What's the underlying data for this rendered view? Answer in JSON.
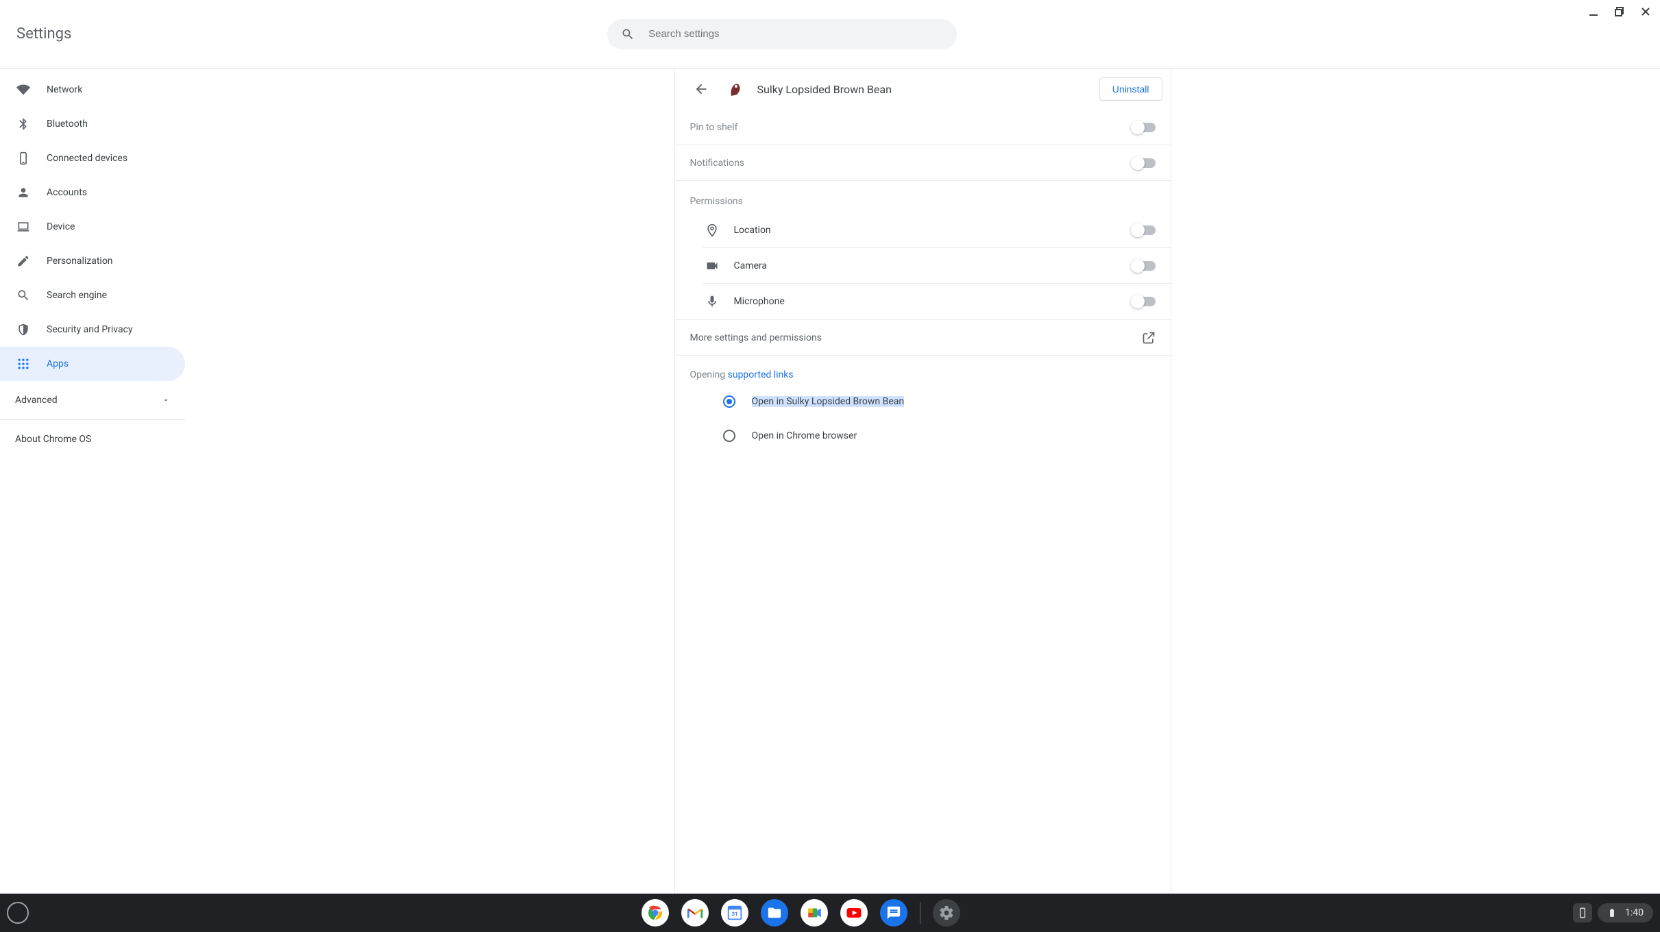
{
  "window": {
    "title": "Settings"
  },
  "search": {
    "placeholder": "Search settings"
  },
  "sidebar": {
    "items": [
      {
        "label": "Network"
      },
      {
        "label": "Bluetooth"
      },
      {
        "label": "Connected devices"
      },
      {
        "label": "Accounts"
      },
      {
        "label": "Device"
      },
      {
        "label": "Personalization"
      },
      {
        "label": "Search engine"
      },
      {
        "label": "Security and Privacy"
      },
      {
        "label": "Apps"
      }
    ],
    "advanced": "Advanced",
    "about": "About Chrome OS"
  },
  "app": {
    "name": "Sulky Lopsided Brown Bean",
    "uninstall": "Uninstall",
    "pin": "Pin to shelf",
    "notifications": "Notifications",
    "permissions_header": "Permissions",
    "permissions": {
      "location": "Location",
      "camera": "Camera",
      "microphone": "Microphone"
    },
    "more": "More settings and permissions",
    "opening_prefix": "Opening ",
    "opening_link": "supported links",
    "open_in_app": "Open in Sulky Lopsided Brown Bean",
    "open_in_chrome": "Open in Chrome browser"
  },
  "shelf": {
    "time": "1:40"
  }
}
